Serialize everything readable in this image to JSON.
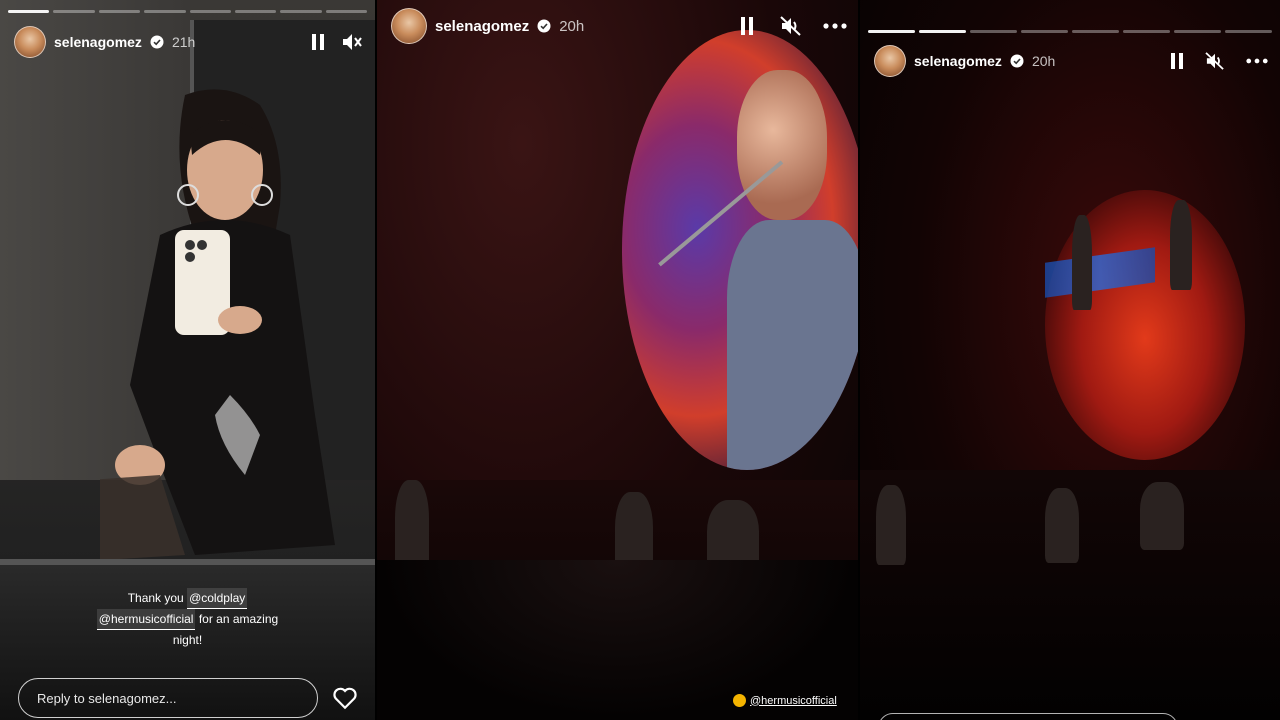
{
  "stories": [
    {
      "username": "selenagomez",
      "time": "21h",
      "progress_segments": 8,
      "progress_done": 1,
      "caption": {
        "line1_prefix": "Thank you",
        "mention1": "@coldplay",
        "mention2": "@hermusicofficial",
        "line2_suffix": "for an amazing",
        "line3": "night!"
      },
      "reply_placeholder": "Reply to selenagomez..."
    },
    {
      "username": "selenagomez",
      "time": "20h",
      "sticker_mention": "@hermusicofficial"
    },
    {
      "username": "selenagomez",
      "time": "20h",
      "progress_segments": 8,
      "progress_done": 2
    }
  ],
  "colors": {
    "verified_badge": "#ffffff",
    "progress_active": "#ffffff"
  },
  "icons": {
    "pause": "pause-icon",
    "mute": "mute-icon",
    "more": "more-icon",
    "verified": "verified-icon",
    "heart": "heart-icon"
  }
}
